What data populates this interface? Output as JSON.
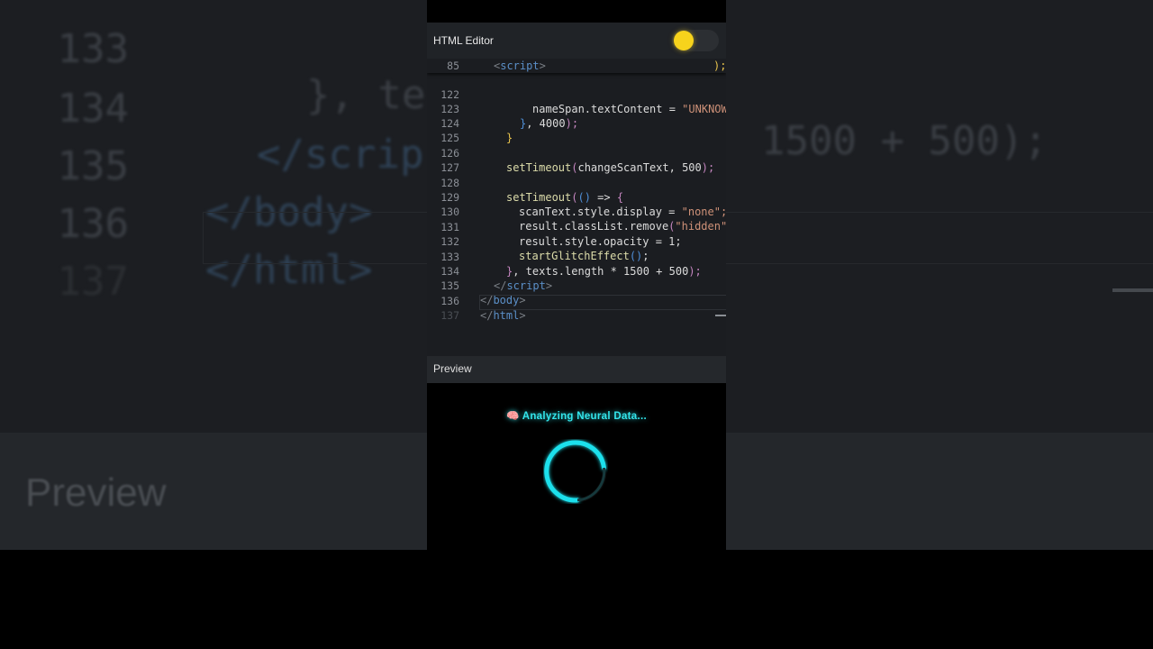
{
  "editor": {
    "title": "HTML Editor",
    "sticky_line": {
      "num": "85",
      "tag_open": "<",
      "tag_name": "script",
      "tag_close": ">",
      "tail": ");"
    },
    "lines": [
      {
        "num": "122",
        "parts": [
          "nameSpan.textContent = ",
          "\"UNKNOW"
        ]
      },
      {
        "num": "123",
        "parts": [
          "}",
          ", 4000",
          ");"
        ]
      },
      {
        "num": "124",
        "parts": [
          "}"
        ]
      },
      {
        "num": "125",
        "parts": [
          ""
        ]
      },
      {
        "num": "126",
        "parts": [
          "setTimeout",
          "(",
          "changeScanText, 500",
          ");"
        ]
      },
      {
        "num": "127",
        "parts": [
          ""
        ]
      },
      {
        "num": "128",
        "parts": [
          "setTimeout",
          "(",
          "()",
          " => ",
          "{"
        ]
      },
      {
        "num": "129",
        "parts": [
          "scanText.style.display = ",
          "\"none\";"
        ]
      },
      {
        "num": "130",
        "parts": [
          "result.classList.remove",
          "(",
          "\"hidden\""
        ]
      },
      {
        "num": "131",
        "parts": [
          "result.style.opacity = 1;"
        ]
      },
      {
        "num": "132",
        "parts": [
          "startGlitchEffect",
          "()",
          ";"
        ]
      },
      {
        "num": "133",
        "parts": [
          "}",
          ", texts.length * 1500 + 500",
          ");"
        ]
      },
      {
        "num": "134",
        "parts": [
          "</",
          "script",
          ">"
        ]
      },
      {
        "num": "135",
        "parts": [
          "</",
          "body",
          ">"
        ]
      },
      {
        "num": "136",
        "parts": [
          "</",
          "html",
          ">"
        ]
      },
      {
        "num": "137",
        "parts": [
          ""
        ]
      }
    ]
  },
  "toggle": {
    "state": "on",
    "color": "#f7d31c"
  },
  "preview": {
    "title": "Preview",
    "scan_icon": "🧠",
    "scan_text": "Analyzing Neural Data...",
    "spinner_color": "#1fe0ec"
  },
  "background": {
    "lines": [
      {
        "num": "133",
        "code_a": "}, te",
        "code_b": "1500 + 500);"
      },
      {
        "num": "134",
        "code_a": "</scrip"
      },
      {
        "num": "135",
        "code_a": "</body>"
      },
      {
        "num": "136",
        "code_a": "</html>"
      },
      {
        "num": "137",
        "code_a": ""
      }
    ],
    "preview_label": "Preview"
  }
}
